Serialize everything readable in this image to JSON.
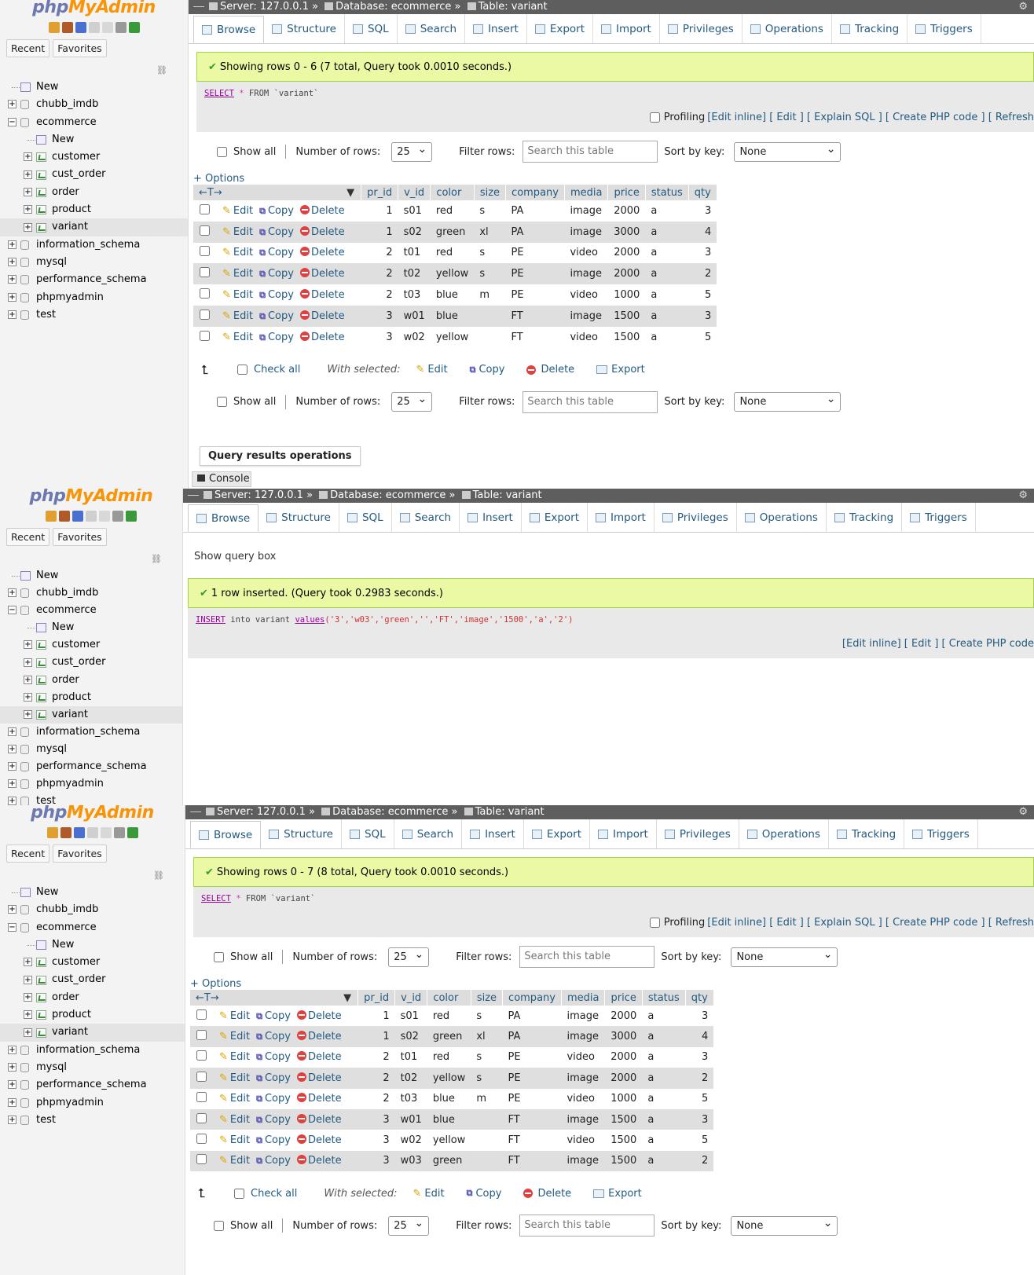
{
  "logo": {
    "part1": "php",
    "part2": "MyAdmin"
  },
  "nav": {
    "recent": "Recent",
    "favorites": "Favorites",
    "link": "⛓",
    "tree": [
      "New",
      "chubb_imdb",
      "ecommerce",
      "New",
      "customer",
      "cust_order",
      "order",
      "product",
      "variant",
      "information_schema",
      "mysql",
      "performance_schema",
      "phpmyadmin",
      "test"
    ]
  },
  "crumb": {
    "server": "Server: 127.0.0.1 »",
    "database": "Database: ecommerce »",
    "table": "Table: variant"
  },
  "tabs": [
    "Browse",
    "Structure",
    "SQL",
    "Search",
    "Insert",
    "Export",
    "Import",
    "Privileges",
    "Operations",
    "Tracking",
    "Triggers"
  ],
  "p1": {
    "msg": "Showing rows 0 - 6 (7 total, Query took 0.0010 seconds.)",
    "sql": {
      "kw": "SELECT",
      "star": "*",
      "from": "FROM",
      "tbl": "`variant`"
    }
  },
  "p2": {
    "show_query": "Show query box",
    "msg": "1 row inserted. (Query took 0.2983 seconds.)",
    "sql": {
      "kw": "INSERT",
      "into": "into variant",
      "values": "values",
      "args": "('3','w03','green','','FT','image','1500','a','2')"
    },
    "links": "[Edit inline] [ Edit ] [ Create PHP code"
  },
  "p3": {
    "msg": "Showing rows 0 - 7 (8 total, Query took 0.0010 seconds.)"
  },
  "profiling": {
    "label": "Profiling",
    "links": "[Edit inline] [ Edit ] [ Explain SQL ] [ Create PHP code ] [ Refresh"
  },
  "controls": {
    "show_all": "Show all",
    "num_rows": "Number of rows:",
    "num_val": "25",
    "filter": "Filter rows:",
    "filter_ph": "Search this table",
    "sort": "Sort by key:",
    "sort_val": "None"
  },
  "options": "+ Options",
  "columns": [
    "pr_id",
    "v_id",
    "color",
    "size",
    "company",
    "media",
    "price",
    "status",
    "qty"
  ],
  "row_actions": {
    "edit": "Edit",
    "copy": "Copy",
    "delete": "Delete"
  },
  "rows": [
    [
      "1",
      "s01",
      "red",
      "s",
      "PA",
      "image",
      "2000",
      "a",
      "3"
    ],
    [
      "1",
      "s02",
      "green",
      "xl",
      "PA",
      "image",
      "3000",
      "a",
      "4"
    ],
    [
      "2",
      "t01",
      "red",
      "s",
      "PE",
      "video",
      "2000",
      "a",
      "3"
    ],
    [
      "2",
      "t02",
      "yellow",
      "s",
      "PE",
      "image",
      "2000",
      "a",
      "2"
    ],
    [
      "2",
      "t03",
      "blue",
      "m",
      "PE",
      "video",
      "1000",
      "a",
      "5"
    ],
    [
      "3",
      "w01",
      "blue",
      "",
      "FT",
      "image",
      "1500",
      "a",
      "3"
    ],
    [
      "3",
      "w02",
      "yellow",
      "",
      "FT",
      "video",
      "1500",
      "a",
      "5"
    ],
    [
      "3",
      "w03",
      "green",
      "",
      "FT",
      "image",
      "1500",
      "a",
      "2"
    ]
  ],
  "with_selected": {
    "check_all": "Check all",
    "label": "With selected:",
    "edit": "Edit",
    "copy": "Copy",
    "delete": "Delete",
    "export": "Export"
  },
  "qro": "Query results operations",
  "console": "Console"
}
